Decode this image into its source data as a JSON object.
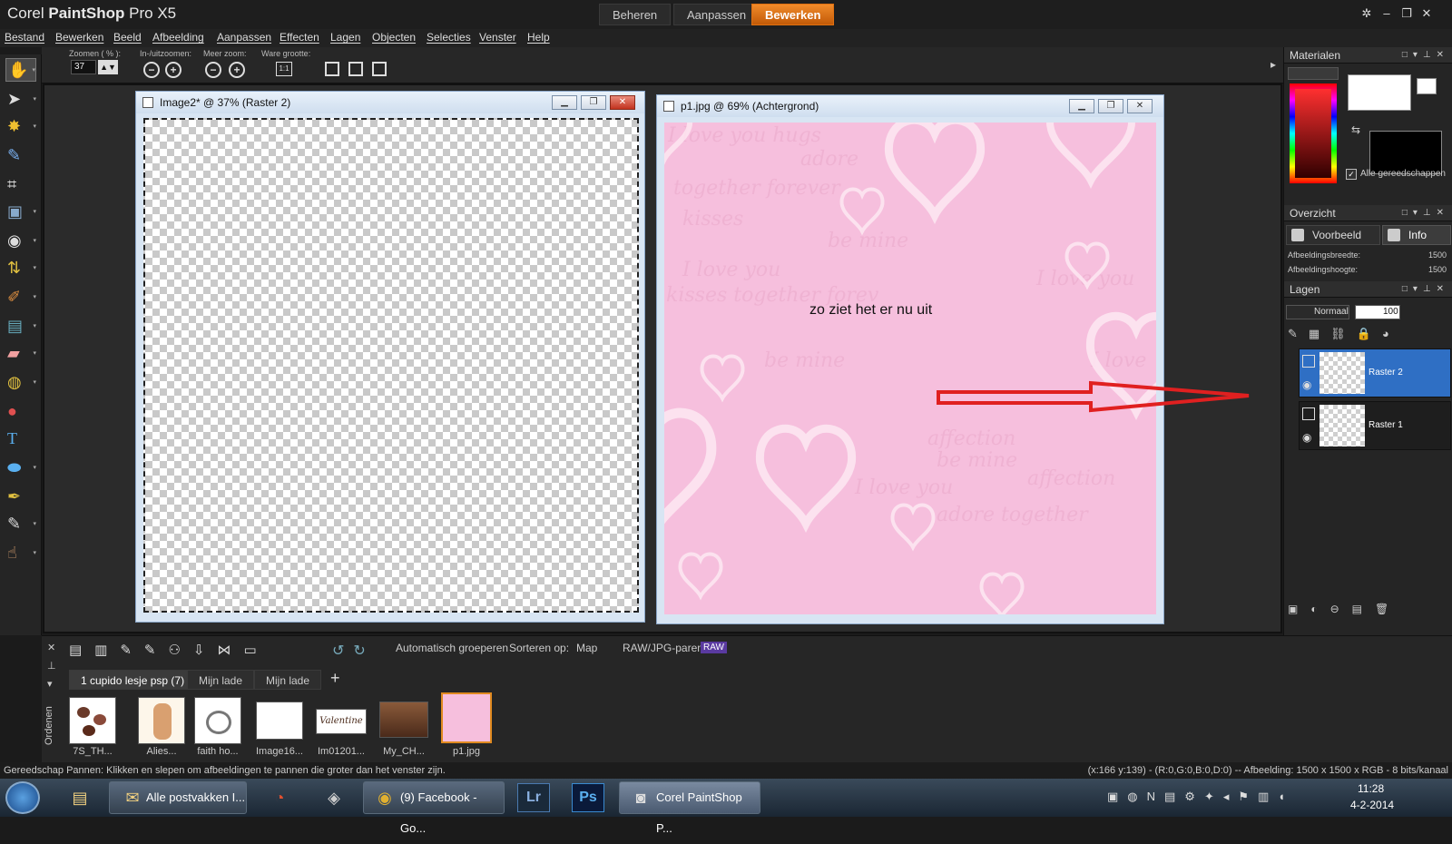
{
  "app": {
    "title_brand": "Corel",
    "title_product": "PaintShop",
    "title_version": "Pro X5"
  },
  "workspace_tabs": [
    "Beheren",
    "Aanpassen",
    "Bewerken"
  ],
  "menu": [
    "Bestand",
    "Bewerken",
    "Beeld",
    "Afbeelding",
    "Aanpassen",
    "Effecten",
    "Lagen",
    "Objecten",
    "Selecties",
    "Venster",
    "Help"
  ],
  "toolbar": {
    "zoom_label": "Zoomen ( % ):",
    "zoom_value": "37",
    "in_out_label": "In-/uitzoomen:",
    "more_zoom_label": "Meer zoom:",
    "actual_size_label": "Ware grootte:",
    "actual_size_icon": "1:1"
  },
  "doc1": {
    "title": "Image2* @  37% (Raster 2)"
  },
  "doc2": {
    "title": "p1.jpg @  69% (Achtergrond)",
    "note": "zo ziet het er nu uit"
  },
  "canvas_script_lines": [
    "I love you  hugs",
    "adore",
    "together forever",
    "kisses",
    "be mine",
    "I love you",
    "kisses  together forev",
    "be mine",
    "I love you",
    "affection",
    "I love",
    "affection",
    "be mine",
    "I love you",
    "adore  together"
  ],
  "panels": {
    "materials": {
      "title": "Materialen",
      "all_tools": "Alle gereedschappen"
    },
    "overview": {
      "title": "Overzicht",
      "tab_preview": "Voorbeeld",
      "tab_info": "Info",
      "width_label": "Afbeeldingsbreedte:",
      "width_value": "1500",
      "height_label": "Afbeeldingshoogte:",
      "height_value": "1500"
    },
    "layers": {
      "title": "Lagen",
      "blend_mode": "Normaal",
      "opacity": "100",
      "items": [
        {
          "name": "Raster 2",
          "selected": true
        },
        {
          "name": "Raster 1",
          "selected": false
        }
      ]
    }
  },
  "organizer": {
    "auto_group": "Automatisch groeperen",
    "sort_label": "Sorteren op:",
    "sort_value": "Map",
    "raw_label": "RAW/JPG-paren:",
    "raw_badge": "RAW",
    "side_label": "Ordenen",
    "tabs": [
      "1 cupido lesje psp (7)",
      "Mijn lade",
      "Mijn lade"
    ],
    "thumbnails": [
      "7S_TH...",
      "Alies...",
      "faith ho...",
      "Image16...",
      "Im01201...",
      "My_CH...",
      "p1.jpg"
    ],
    "valentine_text": "Valentine"
  },
  "status": {
    "left": "Gereedschap Pannen: Klikken en slepen om afbeeldingen te pannen die groter dan het venster zijn.",
    "right": "(x:166 y:139) - (R:0,G:0,B:0,D:0) -- Afbeelding:  1500 x 1500 x RGB - 8 bits/kanaal"
  },
  "taskbar": {
    "buttons": [
      "Alle postvakken I...",
      "(9) Facebook - Go...",
      "Corel PaintShop P..."
    ],
    "icons": [
      "Lr",
      "Ps"
    ],
    "time": "11:28",
    "date": "4-2-2014"
  },
  "colors": {
    "accent": "#e07010",
    "selected_layer": "#2f6fc4",
    "pink_canvas": "#f6bfdd",
    "annotation_arrow": "#e02020"
  }
}
